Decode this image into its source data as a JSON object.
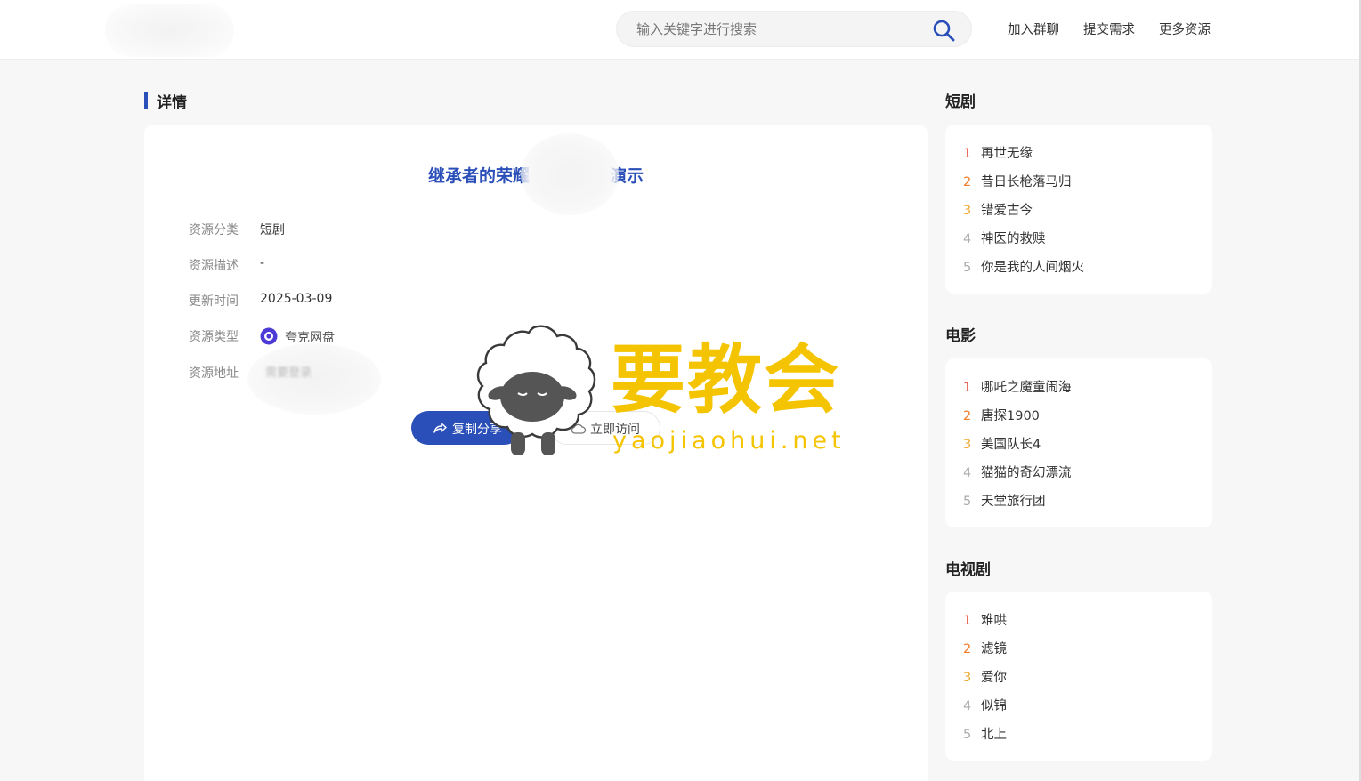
{
  "header": {
    "search_placeholder": "输入关键字进行搜索",
    "nav": [
      "加入群聊",
      "提交需求",
      "更多资源"
    ]
  },
  "detail": {
    "section_title": "详情",
    "resource_title": "继承者的荣耀",
    "resource_title_tail": "演示",
    "fields": [
      {
        "label": "资源分类",
        "value": "短剧"
      },
      {
        "label": "资源描述",
        "value": "-"
      },
      {
        "label": "更新时间",
        "value": "2025-03-09"
      },
      {
        "label": "资源类型",
        "value": "夸克网盘"
      },
      {
        "label": "资源地址",
        "value": "需要登录"
      }
    ],
    "copy_button": "复制分享",
    "visit_button": "立即访问"
  },
  "watermark": {
    "text": "要教会",
    "url": "yaojiaohui.net"
  },
  "sidebar": [
    {
      "title": "短剧",
      "items": [
        "再世无缘",
        "昔日长枪落马归",
        "错爱古今",
        "神医的救赎",
        "你是我的人间烟火"
      ]
    },
    {
      "title": "电影",
      "items": [
        "哪吒之魔童闹海",
        "唐探1900",
        "美国队长4",
        "猫猫的奇幻漂流",
        "天堂旅行团"
      ]
    },
    {
      "title": "电视剧",
      "items": [
        "难哄",
        "滤镜",
        "爱你",
        "似锦",
        "北上"
      ]
    }
  ],
  "ranks": [
    "1",
    "2",
    "3",
    "4",
    "5"
  ],
  "colors": {
    "accent": "#2b4fb8",
    "watermark": "#f5c400",
    "rank1": "#e85a4a",
    "rank2": "#f07c28",
    "rank3": "#f0a830"
  }
}
